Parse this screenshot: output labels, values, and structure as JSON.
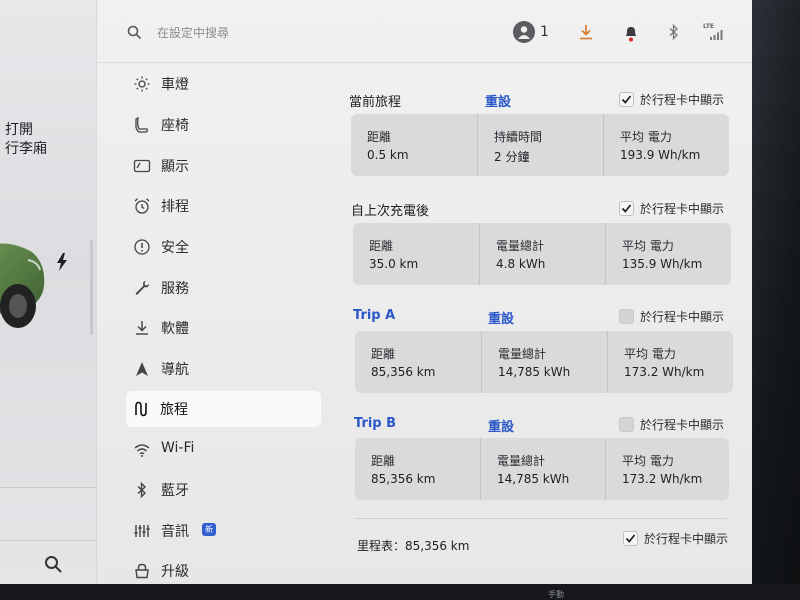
{
  "car_panel": {
    "trunk_line1": "打開",
    "trunk_line2": "行李廂"
  },
  "topbar": {
    "search_placeholder": "在設定中搜尋",
    "profile_count": "1",
    "lte": "LTE",
    "icons": [
      "search-icon",
      "profile-icon",
      "download-icon",
      "bell-icon",
      "bluetooth-icon",
      "signal-icon"
    ],
    "accent_download": "#d9782a",
    "accent_notification": "#d8262b"
  },
  "menu": {
    "items": [
      {
        "label": "車燈",
        "icon": "sun-icon"
      },
      {
        "label": "座椅",
        "icon": "seat-icon"
      },
      {
        "label": "顯示",
        "icon": "display-icon"
      },
      {
        "label": "排程",
        "icon": "alarm-clock-icon"
      },
      {
        "label": "安全",
        "icon": "alert-circle-icon"
      },
      {
        "label": "服務",
        "icon": "wrench-icon"
      },
      {
        "label": "軟體",
        "icon": "download-icon"
      },
      {
        "label": "導航",
        "icon": "navigation-arrow-icon"
      },
      {
        "label": "旅程",
        "icon": "trip-icon",
        "active": true
      },
      {
        "label": "Wi-Fi",
        "icon": "wifi-icon"
      },
      {
        "label": "藍牙",
        "icon": "bluetooth-icon"
      },
      {
        "label": "音訊",
        "icon": "equalizer-icon",
        "badge": "新"
      },
      {
        "label": "升級",
        "icon": "lock-bag-icon"
      }
    ]
  },
  "trips": {
    "current": {
      "title": "當前旅程",
      "reset": "重設",
      "show_on_card": "於行程卡中顯示",
      "checked": true,
      "stats": [
        {
          "label": "距離",
          "value": "0.5 km"
        },
        {
          "label": "持續時間",
          "value": "2 分鐘"
        },
        {
          "label": "平均 電力",
          "value": "193.9 Wh/km"
        }
      ]
    },
    "since_charge": {
      "title": "自上次充電後",
      "show_on_card": "於行程卡中顯示",
      "checked": true,
      "stats": [
        {
          "label": "距離",
          "value": "35.0 km"
        },
        {
          "label": "電量總計",
          "value": "4.8 kWh"
        },
        {
          "label": "平均 電力",
          "value": "135.9 Wh/km"
        }
      ]
    },
    "trip_a": {
      "title": "Trip A",
      "reset": "重設",
      "show_on_card": "於行程卡中顯示",
      "checked": false,
      "stats": [
        {
          "label": "距離",
          "value": "85,356 km"
        },
        {
          "label": "電量總計",
          "value": "14,785 kWh"
        },
        {
          "label": "平均 電力",
          "value": "173.2 Wh/km"
        }
      ]
    },
    "trip_b": {
      "title": "Trip B",
      "reset": "重設",
      "show_on_card": "於行程卡中顯示",
      "checked": false,
      "stats": [
        {
          "label": "距離",
          "value": "85,356 km"
        },
        {
          "label": "電量總計",
          "value": "14,785 kWh"
        },
        {
          "label": "平均 電力",
          "value": "173.2 Wh/km"
        }
      ]
    },
    "odometer": {
      "label": "里程表：85,356 km",
      "show_on_card": "於行程卡中顯示",
      "checked": true
    }
  },
  "bottom_hint": "手動"
}
